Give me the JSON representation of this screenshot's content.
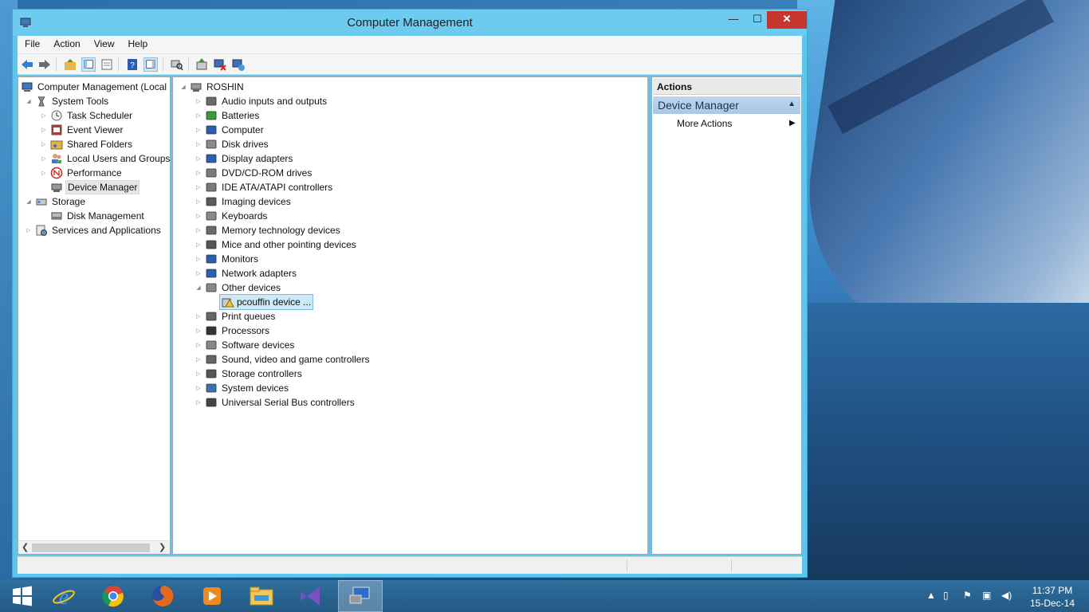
{
  "window": {
    "title": "Computer Management"
  },
  "window_controls": {
    "minimize": "—",
    "maximize": "☐",
    "close": "✕"
  },
  "menu": [
    "File",
    "Action",
    "View",
    "Help"
  ],
  "left_tree": {
    "root": "Computer Management (Local",
    "system_tools": "System Tools",
    "task_scheduler": "Task Scheduler",
    "event_viewer": "Event Viewer",
    "shared_folders": "Shared Folders",
    "local_users": "Local Users and Groups",
    "performance": "Performance",
    "device_manager": "Device Manager",
    "storage": "Storage",
    "disk_management": "Disk Management",
    "services": "Services and Applications"
  },
  "device_tree": {
    "root": "ROSHIN",
    "categories": [
      "Audio inputs and outputs",
      "Batteries",
      "Computer",
      "Disk drives",
      "Display adapters",
      "DVD/CD-ROM drives",
      "IDE ATA/ATAPI controllers",
      "Imaging devices",
      "Keyboards",
      "Memory technology devices",
      "Mice and other pointing devices",
      "Monitors",
      "Network adapters",
      "Other devices",
      "Print queues",
      "Processors",
      "Software devices",
      "Sound, video and game controllers",
      "Storage controllers",
      "System devices",
      "Universal Serial Bus controllers"
    ],
    "other_child": "pcouffin device ..."
  },
  "actions": {
    "header": "Actions",
    "section": "Device Manager",
    "more": "More Actions"
  },
  "taskbar": {
    "apps": [
      "start",
      "internet-explorer",
      "chrome",
      "firefox",
      "media-player",
      "file-explorer",
      "visual-studio",
      "computer-management"
    ],
    "time": "11:37 PM",
    "date": "15-Dec-14"
  }
}
